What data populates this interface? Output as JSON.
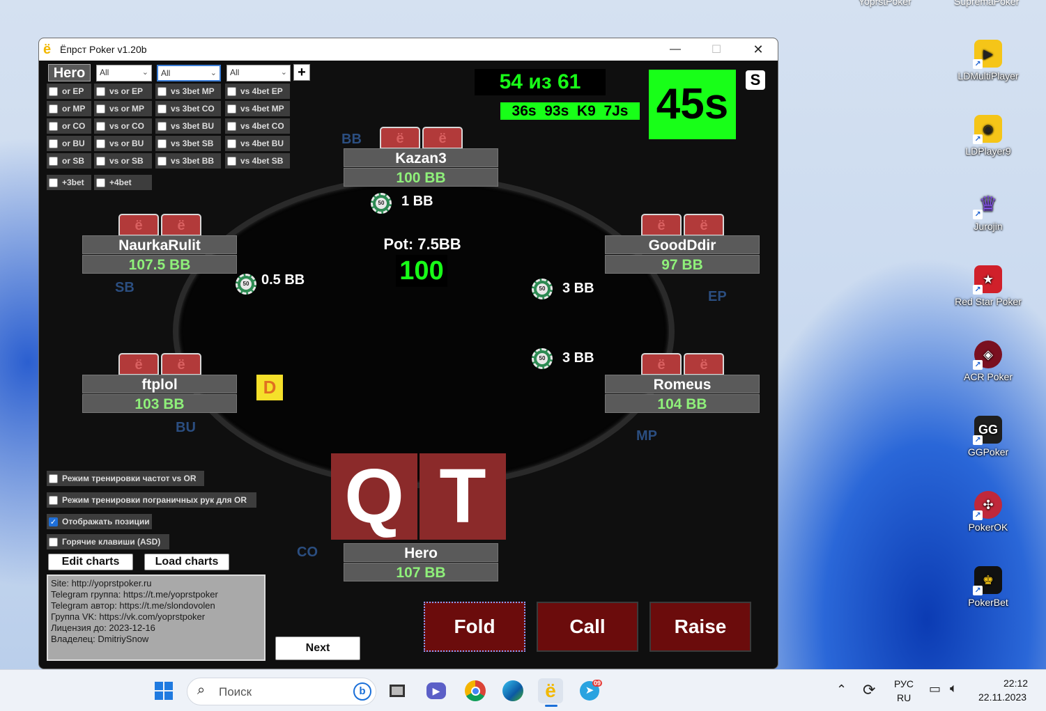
{
  "desktop": {
    "top_labels": [
      "YoprstPoker",
      "SupremaPoker"
    ],
    "icons": [
      {
        "label": "LDMultiPlayer",
        "icon": "ldmultiplayer-icon",
        "glyph": "▶",
        "color": "#f5c518"
      },
      {
        "label": "LDPlayer9",
        "icon": "ldplayer-icon",
        "glyph": "◉",
        "color": "#f5c518"
      },
      {
        "label": "Jurojin",
        "icon": "jurojin-icon",
        "glyph": "♛",
        "color": "#7b4fd6"
      },
      {
        "label": "Red Star Poker",
        "icon": "redstar-icon",
        "glyph": "★",
        "color": "#d0202a"
      },
      {
        "label": "ACR Poker",
        "icon": "acr-icon",
        "glyph": "◈",
        "color": "#b01c2e"
      },
      {
        "label": "GGPoker",
        "icon": "ggpoker-icon",
        "glyph": "GG",
        "color": "#1e1e1e"
      },
      {
        "label": "PokerOK",
        "icon": "pokerok-icon",
        "glyph": "✣",
        "color": "#c0283a"
      },
      {
        "label": "PokerBet",
        "icon": "pokerbet-icon",
        "glyph": "♚",
        "color": "#111111"
      }
    ]
  },
  "window": {
    "title": "Ёпрст Poker v1.20b",
    "app_glyph": "ё",
    "controls": {
      "minimize": "—",
      "maximize": "☐",
      "close": "✕"
    }
  },
  "filters": {
    "hero_label": "Hero",
    "add_label": "+",
    "selects": [
      "All",
      "All",
      "All"
    ],
    "col1": [
      "or EP",
      "or MP",
      "or CO",
      "or BU",
      "or SB"
    ],
    "col2": [
      "vs or EP",
      "vs or MP",
      "vs or CO",
      "vs or BU",
      "vs or SB"
    ],
    "col3": [
      "vs 3bet MP",
      "vs 3bet CO",
      "vs 3bet BU",
      "vs 3bet SB",
      "vs 3bet BB"
    ],
    "col4": [
      "vs 4bet EP",
      "vs 4bet MP",
      "vs 4bet CO",
      "vs 4bet BU",
      "vs 4bet SB"
    ],
    "extra": [
      "+3bet",
      "+4bet"
    ]
  },
  "stats": {
    "progress": "54 из 61",
    "history": "36s  93s  K9  7Js",
    "current_hand": "45s",
    "s_button": "S",
    "colors": {
      "highlight": "#18ff18",
      "text": "#18ff18"
    }
  },
  "table": {
    "pot_label": "Pot: 7.5BB",
    "pot_value": "100",
    "dealer": "D",
    "players": [
      {
        "name": "Kazan3",
        "stack": "100 BB",
        "position": "BB"
      },
      {
        "name": "NaurkaRulit",
        "stack": "107.5 BB",
        "position": "SB"
      },
      {
        "name": "GoodDdir",
        "stack": "97 BB",
        "position": "EP"
      },
      {
        "name": "ftplol",
        "stack": "103 BB",
        "position": "BU"
      },
      {
        "name": "Romeus",
        "stack": "104 BB",
        "position": "MP"
      },
      {
        "name": "Hero",
        "stack": "107 BB",
        "position": "CO"
      }
    ],
    "bets": [
      "1 BB",
      "0.5 BB",
      "3 BB",
      "3 BB"
    ],
    "chip_label": "50",
    "card_back_glyph": "ё",
    "hero_cards": [
      "Q",
      "T"
    ]
  },
  "options": [
    {
      "label": "Режим тренировки частот vs OR",
      "checked": false
    },
    {
      "label": "Режим тренировки пограничных рук для OR",
      "checked": false
    },
    {
      "label": "Отображать позиции",
      "checked": true
    },
    {
      "label": "Горячие клавиши (ASD)",
      "checked": false
    }
  ],
  "buttons": {
    "edit_charts": "Edit charts",
    "load_charts": "Load charts",
    "next": "Next"
  },
  "actions": {
    "fold": "Fold",
    "call": "Call",
    "raise": "Raise"
  },
  "info_lines": [
    "Site: http://yoprstpoker.ru",
    "Telegram группа: https://t.me/yoprstpoker",
    "Telegram автор: https://t.me/slondovolen",
    "Группа VK: https://vk.com/yoprstpoker",
    "Лицензия до: 2023-12-16",
    "Владелец: DmitriySnow"
  ],
  "taskbar": {
    "search_placeholder": "Поиск",
    "lang_top": "РУС",
    "lang_bottom": "RU",
    "time": "22:12",
    "date": "22.11.2023",
    "telegram_badge": "09"
  }
}
